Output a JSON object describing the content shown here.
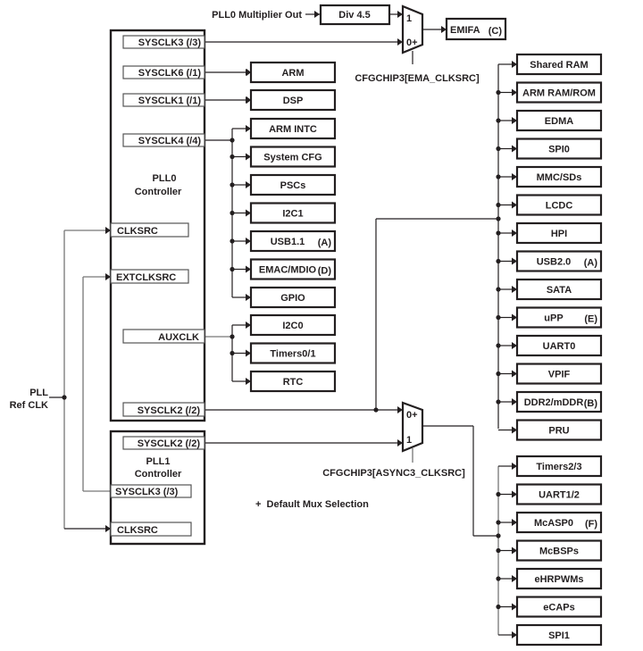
{
  "diagram": {
    "pll_ref_clk": [
      "PLL",
      "Ref CLK"
    ],
    "pll0_mult_out": "PLL0 Multiplier Out",
    "div_box": "Div 4.5",
    "emifa_mux": {
      "inputs": [
        "1",
        "0+"
      ],
      "select_label": "CFGCHIP3[EMA_CLKSRC]"
    },
    "emifa": {
      "name": "EMIFA",
      "note": "(C)"
    },
    "pll0": {
      "title": [
        "PLL0",
        "Controller"
      ],
      "ports": {
        "sysclk3": "SYSCLK3 (/3)",
        "sysclk6": "SYSCLK6 (/1)",
        "sysclk1": "SYSCLK1 (/1)",
        "sysclk4": "SYSCLK4 (/4)",
        "clksrc": "CLKSRC",
        "extclksrc": "EXTCLKSRC",
        "auxclk": "AUXCLK",
        "sysclk2": "SYSCLK2 (/2)"
      }
    },
    "pll1": {
      "title": [
        "PLL1",
        "Controller"
      ],
      "ports": {
        "sysclk2": "SYSCLK2 (/2)",
        "sysclk3": "SYSCLK3 (/3)",
        "clksrc": "CLKSRC"
      }
    },
    "sysclk6_targets": [
      {
        "name": "ARM",
        "note": ""
      }
    ],
    "sysclk1_targets": [
      {
        "name": "DSP",
        "note": ""
      }
    ],
    "sysclk4_targets": [
      {
        "name": "ARM INTC",
        "note": ""
      },
      {
        "name": "System CFG",
        "note": ""
      },
      {
        "name": "PSCs",
        "note": ""
      },
      {
        "name": "I2C1",
        "note": ""
      },
      {
        "name": "USB1.1",
        "note": "(A)"
      },
      {
        "name": "EMAC/MDIO",
        "note": "(D)"
      },
      {
        "name": "GPIO",
        "note": ""
      }
    ],
    "auxclk_targets": [
      {
        "name": "I2C0",
        "note": ""
      },
      {
        "name": "Timers0/1",
        "note": ""
      },
      {
        "name": "RTC",
        "note": ""
      }
    ],
    "sysclk2_targets": [
      {
        "name": "Shared RAM",
        "note": ""
      },
      {
        "name": "ARM RAM/ROM",
        "note": ""
      },
      {
        "name": "EDMA",
        "note": ""
      },
      {
        "name": "SPI0",
        "note": ""
      },
      {
        "name": "MMC/SDs",
        "note": ""
      },
      {
        "name": "LCDC",
        "note": ""
      },
      {
        "name": "HPI",
        "note": ""
      },
      {
        "name": "USB2.0",
        "note": "(A)"
      },
      {
        "name": "SATA",
        "note": ""
      },
      {
        "name": "uPP",
        "note": "(E)"
      },
      {
        "name": "UART0",
        "note": ""
      },
      {
        "name": "VPIF",
        "note": ""
      },
      {
        "name": "DDR2/mDDR",
        "note": "(B)"
      },
      {
        "name": "PRU",
        "note": ""
      }
    ],
    "async3_mux": {
      "inputs": [
        "0+",
        "1"
      ],
      "select_label": "CFGCHIP3[ASYNC3_CLKSRC]"
    },
    "async3_targets": [
      {
        "name": "Timers2/3",
        "note": ""
      },
      {
        "name": "UART1/2",
        "note": ""
      },
      {
        "name": "McASP0",
        "note": "(F)"
      },
      {
        "name": "McBSPs",
        "note": ""
      },
      {
        "name": "eHRPWMs",
        "note": ""
      },
      {
        "name": "eCAPs",
        "note": ""
      },
      {
        "name": "SPI1",
        "note": ""
      }
    ],
    "legend": "+  Default Mux Selection"
  }
}
